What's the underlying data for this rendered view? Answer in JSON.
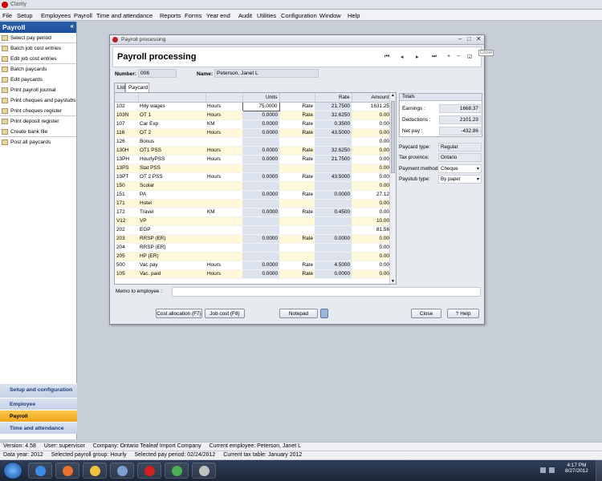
{
  "app": {
    "title": "Clarity"
  },
  "menu": [
    "File",
    "Setup",
    "Employees",
    "Payroll",
    "Time and attendance",
    "Reports",
    "Forms",
    "Year end",
    "Audit",
    "Utilities",
    "Configuration",
    "Window",
    "Help"
  ],
  "sidebar": {
    "title": "Payroll",
    "collapse": "«",
    "items": [
      {
        "label": "Select pay period",
        "icon": "calendar-icon",
        "sep": true
      },
      {
        "label": "Batch job cost entries",
        "icon": "batch-icon",
        "sep": false
      },
      {
        "label": "Edit job cost entries",
        "icon": "edit-icon",
        "sep": true
      },
      {
        "label": "Batch paycards",
        "icon": "batch-icon",
        "sep": false
      },
      {
        "label": "Edit paycards",
        "icon": "edit-icon",
        "sep": false
      },
      {
        "label": "Print payroll journal",
        "icon": "print-icon",
        "sep": false
      },
      {
        "label": "Print cheques and paystubs",
        "icon": "print-icon",
        "sep": false
      },
      {
        "label": "Print cheques register",
        "icon": "print-icon",
        "sep": true
      },
      {
        "label": "Print deposit register",
        "icon": "print-icon",
        "sep": false
      },
      {
        "label": "Create bank file",
        "icon": "file-icon",
        "sep": true
      },
      {
        "label": "Post all paycards",
        "icon": "post-icon",
        "sep": false
      }
    ],
    "sections": [
      "Setup and configuration",
      "Employee",
      "Payroll",
      "Time and attendance"
    ],
    "active_section": "Payroll"
  },
  "window": {
    "caption": "Payroll processing",
    "heading": "Payroll processing",
    "close_tip": "Close",
    "number_label": "Number:",
    "number_value": "006",
    "name_label": "Name:",
    "name_value": "Peterson, Janet L",
    "tabs": [
      "List",
      "Paycard"
    ],
    "active_tab": "Paycard",
    "columns": [
      "",
      "",
      "",
      "Units",
      "",
      "Rate",
      "Amount"
    ],
    "rows": [
      {
        "code": "102",
        "desc": "Hrly wages",
        "unit": "Hours",
        "units": "75.0000",
        "rl": "Rate",
        "rate": "21.7500",
        "amount": "1631.25",
        "alt": false,
        "u": true,
        "r": true
      },
      {
        "code": "103N",
        "desc": "OT 1",
        "unit": "Hours",
        "units": "0.0000",
        "rl": "Rate",
        "rate": "32.6250",
        "amount": "0.00",
        "alt": true,
        "u": true,
        "r": true
      },
      {
        "code": "107",
        "desc": "Car Exp",
        "unit": "KM",
        "units": "0.0000",
        "rl": "Rate",
        "rate": "0.3500",
        "amount": "0.00",
        "alt": false,
        "u": true,
        "r": true
      },
      {
        "code": "116",
        "desc": "OT 2",
        "unit": "Hours",
        "units": "0.0000",
        "rl": "Rate",
        "rate": "43.5000",
        "amount": "0.00",
        "alt": true,
        "u": true,
        "r": true
      },
      {
        "code": "126",
        "desc": "Bonus",
        "unit": "",
        "units": "",
        "rl": "",
        "rate": "",
        "amount": "0.00",
        "alt": false,
        "u": true,
        "r": true
      },
      {
        "code": "130H",
        "desc": "OT1 PSS",
        "unit": "Hours",
        "units": "0.0000",
        "rl": "Rate",
        "rate": "32.6250",
        "amount": "0.00",
        "alt": true,
        "u": true,
        "r": true
      },
      {
        "code": "13PH",
        "desc": "HourlyPSS",
        "unit": "Hours",
        "units": "0.0000",
        "rl": "Rate",
        "rate": "21.7500",
        "amount": "0.00",
        "alt": false,
        "u": true,
        "r": true
      },
      {
        "code": "13PS",
        "desc": "Stat PSS",
        "unit": "",
        "units": "",
        "rl": "",
        "rate": "",
        "amount": "0.00",
        "alt": true,
        "u": true,
        "r": true
      },
      {
        "code": "13PT",
        "desc": "OT 2 PSS",
        "unit": "Hours",
        "units": "0.0000",
        "rl": "Rate",
        "rate": "43.5000",
        "amount": "0.00",
        "alt": false,
        "u": true,
        "r": true
      },
      {
        "code": "150",
        "desc": "Scolar",
        "unit": "",
        "units": "",
        "rl": "",
        "rate": "",
        "amount": "0.00",
        "alt": true,
        "u": true,
        "r": true
      },
      {
        "code": "151",
        "desc": "PA",
        "unit": "",
        "units": "0.0000",
        "rl": "Rate",
        "rate": "0.0000",
        "amount": "27.12",
        "alt": false,
        "u": true,
        "r": true
      },
      {
        "code": "171",
        "desc": "Hotel",
        "unit": "",
        "units": "",
        "rl": "",
        "rate": "",
        "amount": "0.00",
        "alt": true,
        "u": true,
        "r": true
      },
      {
        "code": "172",
        "desc": "Travel",
        "unit": "KM",
        "units": "0.0000",
        "rl": "Rate",
        "rate": "0.4500",
        "amount": "0.00",
        "alt": false,
        "u": true,
        "r": true
      },
      {
        "code": "V12",
        "desc": "VP",
        "unit": "",
        "units": "",
        "rl": "",
        "rate": "",
        "amount": "10.00",
        "alt": true,
        "u": true,
        "r": true
      },
      {
        "code": "202",
        "desc": "EGP",
        "unit": "",
        "units": "",
        "rl": "",
        "rate": "",
        "amount": "81.56",
        "alt": false,
        "u": true,
        "r": true
      },
      {
        "code": "203",
        "desc": "RRSP  (ER)",
        "unit": "",
        "units": "0.0000",
        "rl": "Rate",
        "rate": "0.0000",
        "amount": "0.00",
        "alt": true,
        "u": true,
        "r": true
      },
      {
        "code": "204",
        "desc": "RRSP  (ER)",
        "unit": "",
        "units": "",
        "rl": "",
        "rate": "",
        "amount": "0.00",
        "alt": false,
        "u": true,
        "r": true
      },
      {
        "code": "205",
        "desc": "HP (ER)",
        "unit": "",
        "units": "",
        "rl": "",
        "rate": "",
        "amount": "0.00",
        "alt": true,
        "u": true,
        "r": true
      },
      {
        "code": "500",
        "desc": "Vac pay",
        "unit": "Hours",
        "units": "0.0000",
        "rl": "Rate",
        "rate": "4.5000",
        "amount": "0.00",
        "alt": false,
        "u": true,
        "r": true
      },
      {
        "code": "105",
        "desc": "Vac. paid",
        "unit": "Hours",
        "units": "0.0000",
        "rl": "Rate",
        "rate": "0.0000",
        "amount": "0.00",
        "alt": true,
        "u": true,
        "r": true
      }
    ],
    "totals": {
      "title": "Totals",
      "earnings_label": "Earnings :",
      "earnings": "1668.37",
      "deductions_label": "Deductions :",
      "deductions": "2101.23",
      "netpay_label": "Net pay :",
      "netpay": "-432.86"
    },
    "props": [
      {
        "label": "Paycard type:",
        "value": "Regular",
        "dd": false
      },
      {
        "label": "Tax province:",
        "value": "Ontario",
        "dd": false
      },
      {
        "label": "Payment method:",
        "value": "Cheque",
        "dd": true
      },
      {
        "label": "Paystub type:",
        "value": "By paper",
        "dd": true
      }
    ],
    "memo_label": "Memo to employee :",
    "memo_value": "",
    "buttons": {
      "cost_allocation": "Cost allocation (F7)",
      "job_cost": "Job cost (F8)",
      "notepad": "Notepad",
      "close": "Close",
      "help": "Help"
    },
    "nav": [
      "⏮",
      "◂",
      "▸",
      "⏭",
      "+",
      "−",
      "☑"
    ]
  },
  "status": {
    "version": "Version: 4.58",
    "user": "User: supervisor",
    "company": "Company: Ontario Tealeaf Import Company",
    "employee": "Current employee: Peterson, Janet L",
    "data_year": "Data year: 2012",
    "pay_group": "Selected payroll group: Hourly",
    "pay_period": "Selected pay period: 02/24/2012",
    "tax_table": "Current tax table: January 2012"
  },
  "taskbar": {
    "time": "4:17 PM",
    "date": "8/27/2012",
    "apps": [
      {
        "name": "ie-icon",
        "color": "#3a8ee6"
      },
      {
        "name": "firefox-icon",
        "color": "#e8702a"
      },
      {
        "name": "outlook-icon",
        "color": "#f0c040"
      },
      {
        "name": "network-icon",
        "color": "#7aa0d0"
      },
      {
        "name": "record-icon",
        "color": "#d02020"
      },
      {
        "name": "chrome-icon",
        "color": "#4caf50"
      },
      {
        "name": "tool-icon",
        "color": "#c0c0c0"
      }
    ]
  }
}
